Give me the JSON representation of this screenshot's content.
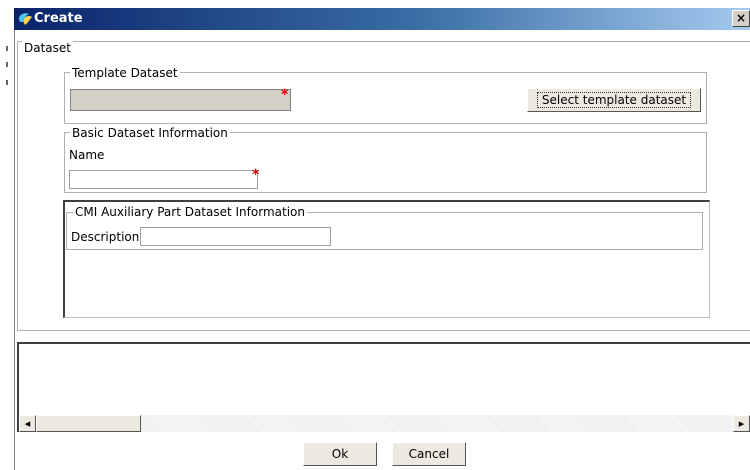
{
  "window": {
    "title": "Create",
    "close_glyph": "×"
  },
  "dataset_group": {
    "legend": "Dataset"
  },
  "template_group": {
    "legend": "Template Dataset",
    "input_value": "",
    "required_mark": "*",
    "select_button_label": "Select template dataset"
  },
  "basic_group": {
    "legend": "Basic Dataset Information",
    "name_label": "Name",
    "name_value": "",
    "required_mark": "*"
  },
  "cmi_group": {
    "legend": "CMI Auxiliary Part Dataset Information",
    "description_label": "Description",
    "description_value": ""
  },
  "footer": {
    "ok_label": "Ok",
    "cancel_label": "Cancel"
  },
  "scrollbar": {
    "left_arrow": "◂",
    "right_arrow": "▸"
  },
  "colors": {
    "required": "#e00000",
    "titlebar_start": "#0a246a",
    "titlebar_end": "#a6caf0"
  }
}
